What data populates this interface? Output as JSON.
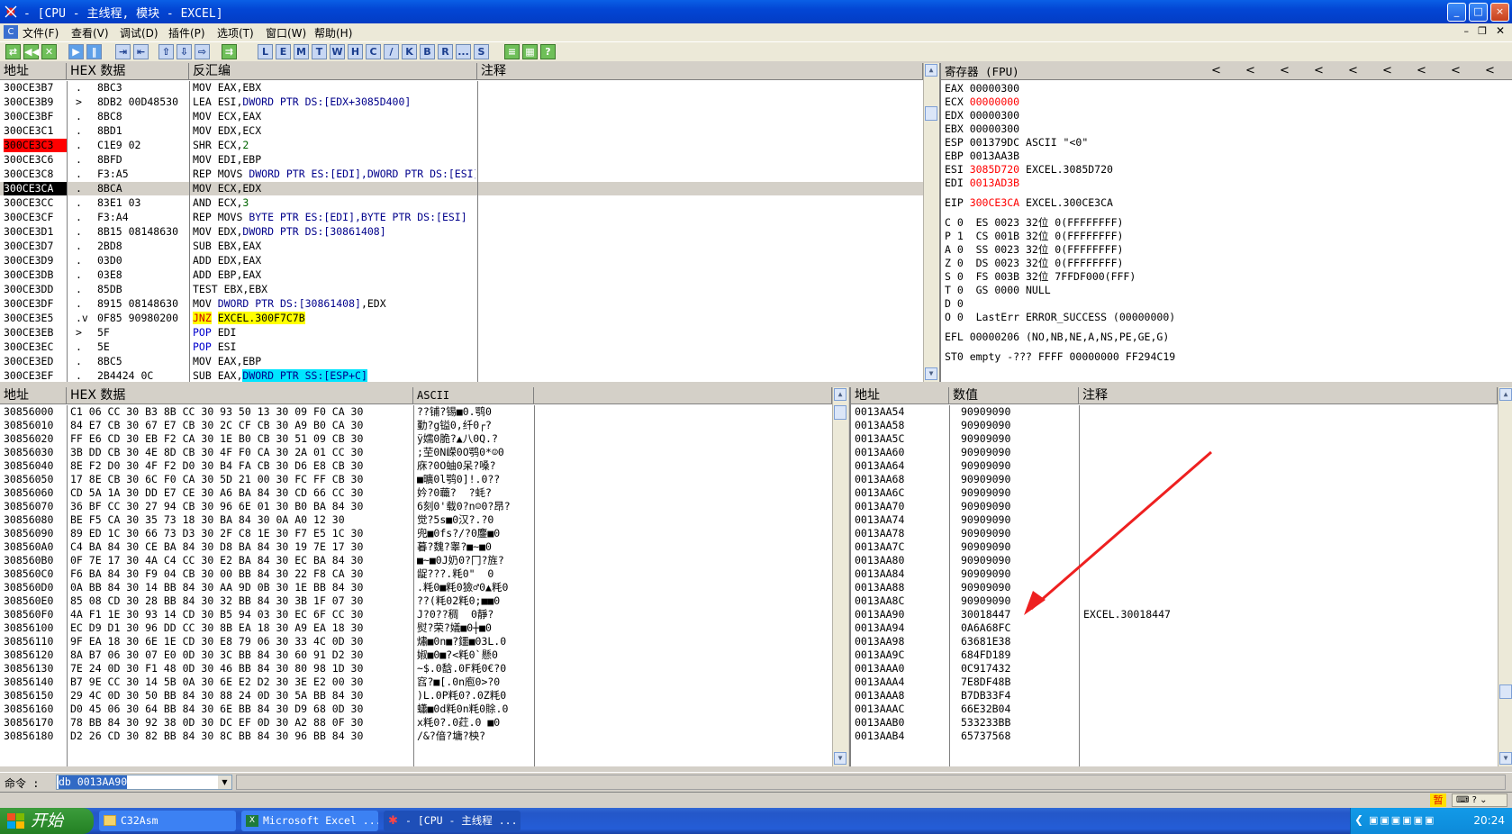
{
  "window": {
    "title": "- [CPU - 主线程, 模块 - EXCEL]",
    "minimize": "_",
    "maximize": "□",
    "close": "×"
  },
  "menu": [
    "文件(F)",
    "查看(V)",
    "调试(D)",
    "插件(P)",
    "选项(T)",
    "窗口(W)",
    "帮助(H)"
  ],
  "toolbar": {
    "play_buttons": [
      "◀◀",
      "✕",
      "▶",
      "‖",
      "⇥",
      "⇤",
      "⇧",
      "⇩",
      "⇨",
      "⇉"
    ],
    "letters": [
      "L",
      "E",
      "M",
      "T",
      "W",
      "H",
      "C",
      "/",
      "K",
      "B",
      "R",
      "...",
      "S"
    ]
  },
  "disasm": {
    "headers": [
      "地址",
      "HEX 数据",
      "反汇编",
      "注释"
    ],
    "rows": [
      {
        "addr": "300CE3B7",
        "mark": ".",
        "hex": "8BC3",
        "asm": [
          [
            "MOV EAX,EBX",
            ""
          ]
        ]
      },
      {
        "addr": "300CE3B9",
        "mark": ">",
        "hex": "8DB2 00D48530",
        "asm": [
          [
            "LEA ESI,",
            ""
          ],
          [
            "DWORD PTR DS:[EDX+3085D400]",
            "blue"
          ]
        ]
      },
      {
        "addr": "300CE3BF",
        "mark": ".",
        "hex": "8BC8",
        "asm": [
          [
            "MOV ECX,EAX",
            ""
          ]
        ]
      },
      {
        "addr": "300CE3C1",
        "mark": ".",
        "hex": "8BD1",
        "asm": [
          [
            "MOV EDX,ECX",
            ""
          ]
        ]
      },
      {
        "addr": "300CE3C3",
        "mark": ".",
        "hex": "C1E9 02",
        "asm": [
          [
            "SHR ECX,",
            ""
          ],
          [
            "2",
            "green"
          ]
        ],
        "hl": "red"
      },
      {
        "addr": "300CE3C6",
        "mark": ".",
        "hex": "8BFD",
        "asm": [
          [
            "MOV EDI,EBP",
            ""
          ]
        ]
      },
      {
        "addr": "300CE3C8",
        "mark": ".",
        "hex": "F3:A5",
        "asm": [
          [
            "REP MOVS ",
            ""
          ],
          [
            "DWORD PTR ES:[EDI],DWORD PTR DS:[ESI]",
            "blue"
          ]
        ]
      },
      {
        "addr": "300CE3CA",
        "mark": ".",
        "hex": "8BCA",
        "asm": [
          [
            "MOV ECX,EDX",
            ""
          ]
        ],
        "hl": "blk"
      },
      {
        "addr": "300CE3CC",
        "mark": ".",
        "hex": "83E1 03",
        "asm": [
          [
            "AND ECX,",
            ""
          ],
          [
            "3",
            "green"
          ]
        ]
      },
      {
        "addr": "300CE3CF",
        "mark": ".",
        "hex": "F3:A4",
        "asm": [
          [
            "REP MOVS ",
            ""
          ],
          [
            "BYTE PTR ES:[EDI],BYTE PTR DS:[ESI]",
            "blue"
          ]
        ]
      },
      {
        "addr": "300CE3D1",
        "mark": ".",
        "hex": "8B15 08148630",
        "asm": [
          [
            "MOV EDX,",
            ""
          ],
          [
            "DWORD PTR DS:[30861408]",
            "blue"
          ]
        ]
      },
      {
        "addr": "300CE3D7",
        "mark": ".",
        "hex": "2BD8",
        "asm": [
          [
            "SUB EBX,EAX",
            ""
          ]
        ]
      },
      {
        "addr": "300CE3D9",
        "mark": ".",
        "hex": "03D0",
        "asm": [
          [
            "ADD EDX,EAX",
            ""
          ]
        ]
      },
      {
        "addr": "300CE3DB",
        "mark": ".",
        "hex": "03E8",
        "asm": [
          [
            "ADD EBP,EAX",
            ""
          ]
        ]
      },
      {
        "addr": "300CE3DD",
        "mark": ".",
        "hex": "85DB",
        "asm": [
          [
            "TEST EBX,EBX",
            ""
          ]
        ]
      },
      {
        "addr": "300CE3DF",
        "mark": ".",
        "hex": "8915 08148630",
        "asm": [
          [
            "MOV ",
            ""
          ],
          [
            "DWORD PTR DS:[30861408]",
            "blue"
          ],
          [
            ",EDX",
            ""
          ]
        ]
      },
      {
        "addr": "300CE3E5",
        "mark": ".v",
        "hex": "0F85 90980200",
        "asm": [
          [
            "JNZ",
            "jnz"
          ],
          [
            " ",
            ""
          ],
          [
            "EXCEL.300F7C7B",
            "yel"
          ]
        ]
      },
      {
        "addr": "300CE3EB",
        "mark": ">",
        "hex": "5F",
        "asm": [
          [
            "POP",
            "pop"
          ],
          [
            " EDI",
            ""
          ]
        ]
      },
      {
        "addr": "300CE3EC",
        "mark": ".",
        "hex": "5E",
        "asm": [
          [
            "POP",
            "pop"
          ],
          [
            " ESI",
            ""
          ]
        ]
      },
      {
        "addr": "300CE3ED",
        "mark": ".",
        "hex": "8BC5",
        "asm": [
          [
            "MOV EAX,EBP",
            ""
          ]
        ]
      },
      {
        "addr": "300CE3EF",
        "mark": ".",
        "hex": "2B4424 0C",
        "asm": [
          [
            "SUB EAX,",
            ""
          ],
          [
            "DWORD PTR SS:[ESP+C]",
            "cyan"
          ]
        ]
      }
    ]
  },
  "registers": {
    "title": "寄存器 (FPU)",
    "arrows": [
      "<",
      "<",
      "<",
      "<",
      "<",
      "<",
      "<",
      "<",
      "<"
    ],
    "lines": [
      [
        [
          "EAX ",
          ""
        ],
        [
          "00000300",
          ""
        ]
      ],
      [
        [
          "ECX ",
          ""
        ],
        [
          "00000000",
          "red"
        ]
      ],
      [
        [
          "EDX ",
          ""
        ],
        [
          "00000300",
          ""
        ]
      ],
      [
        [
          "EBX ",
          ""
        ],
        [
          "00000300",
          ""
        ]
      ],
      [
        [
          "ESP ",
          ""
        ],
        [
          "001379DC",
          ""
        ],
        [
          " ASCII \"<0\"",
          ""
        ]
      ],
      [
        [
          "EBP ",
          ""
        ],
        [
          "0013AA3B",
          ""
        ]
      ],
      [
        [
          "ESI ",
          ""
        ],
        [
          "3085D720",
          "red"
        ],
        [
          " EXCEL.3085D720",
          ""
        ]
      ],
      [
        [
          "EDI ",
          ""
        ],
        [
          "0013AD3B",
          "red"
        ]
      ],
      [
        [
          "",
          ""
        ]
      ],
      [
        [
          "EIP ",
          ""
        ],
        [
          "300CE3CA",
          "red"
        ],
        [
          " EXCEL.300CE3CA",
          ""
        ]
      ],
      [
        [
          "",
          ""
        ]
      ],
      [
        [
          "C 0  ES 0023 32位 0(FFFFFFFF)",
          ""
        ]
      ],
      [
        [
          "P 1  CS 001B 32位 0(FFFFFFFF)",
          ""
        ]
      ],
      [
        [
          "A 0  SS 0023 32位 0(FFFFFFFF)",
          ""
        ]
      ],
      [
        [
          "Z 0  DS 0023 32位 0(FFFFFFFF)",
          ""
        ]
      ],
      [
        [
          "S 0  FS 003B 32位 7FFDF000(FFF)",
          ""
        ]
      ],
      [
        [
          "T 0  GS 0000 NULL",
          ""
        ]
      ],
      [
        [
          "D 0",
          ""
        ]
      ],
      [
        [
          "O 0  LastErr ERROR_SUCCESS (00000000)",
          ""
        ]
      ],
      [
        [
          "",
          ""
        ]
      ],
      [
        [
          "EFL 00000206 (NO,NB,NE,A,NS,PE,GE,G)",
          ""
        ]
      ],
      [
        [
          "",
          ""
        ]
      ],
      [
        [
          "ST0 empty -??? FFFF 00000000 FF294C19",
          ""
        ]
      ]
    ]
  },
  "dump": {
    "headers": [
      "地址",
      "HEX 数据",
      "ASCII"
    ],
    "rows": [
      [
        "30856000",
        "C1 06 CC 30 B3 8B CC 30 93 50 13 30 09 F0 CA 30",
        "??铺?锡■0.鹗0"
      ],
      [
        "30856010",
        "84 E7 CB 30 67 E7 CB 30 2C CF CB 30 A9 B0 CA 30",
        "勤?g镒0,纤0┌?"
      ],
      [
        "30856020",
        "FF E6 CD 30 EB F2 CA 30 1E B0 CB 30 51 09 CB 30",
        "ÿ嬬0脆?▲八0Q.?"
      ],
      [
        "30856030",
        "3B DD CB 30 4E 8D CB 30 4F F0 CA 30 2A 01 CC 30",
        ";茔0N嵘0O鹗0*☺0"
      ],
      [
        "30856040",
        "8E F2 D0 30 4F F2 D0 30 B4 FA CB 30 D6 E8 CB 30",
        "庥?0O蚰0呆?嗓?"
      ],
      [
        "30856050",
        "17 8E CB 30 6C F0 CA 30 5D 21 00 30 FC FF CB 30",
        "■曠0l鹗0]!.0??"
      ],
      [
        "30856060",
        "CD 5A 1A 30 DD E7 CE 30 A6 BA 84 30 CD 66 CC 30",
        "妗?0蘵?  ?蚝?"
      ],
      [
        "30856070",
        "36 BF CC 30 27 94 CB 30 96 6E 01 30 B0 BA 84 30",
        "6刻0'载0?n☺0?昂?"
      ],
      [
        "30856080",
        "BE F5 CA 30 35 73 18 30 BA 84 30 0A A0 12 30",
        "觉?5s■0汉?.?0"
      ],
      [
        "30856090",
        "89 ED 1C 30 66 73 D3 30 2F C8 1E 30 F7 E5 1C 30",
        "兜■0fs?/?0鏖■0"
      ],
      [
        "308560A0",
        "C4 BA 84 30 CE BA 84 30 D8 BA 84 30 19 7E 17 30",
        "暮?魏?睾?■~■0"
      ],
      [
        "308560B0",
        "0F 7E 17 30 4A C4 CC 30 E2 BA 84 30 EC BA 84 30",
        "■~■0J奶0?冂?旌?"
      ],
      [
        "308560C0",
        "F6 BA 84 30 F9 04 CB 30 00 BB 84 30 22 F8 CA 30",
        "龊???.粍0\"  0"
      ],
      [
        "308560D0",
        "0A BB 84 30 14 BB 84 30 AA 9D 0B 30 1E BB 84 30",
        ".粍0■粍0獫♂0▲粍0"
      ],
      [
        "308560E0",
        "85 08 CD 30 28 BB 84 30 32 BB 84 30 3B 1F 07 30",
        "??(粍02粍0;■■0"
      ],
      [
        "308560F0",
        "4A F1 1E 30 93 14 CD 30 B5 94 03 30 EC 6F CC 30",
        "J?0??稠  0靜?"
      ],
      [
        "30856100",
        "EC D9 D1 30 96 DD CC 30 8B EA 18 30 A9 EA 18 30",
        "熨?荣?嬟■0┼■0"
      ],
      [
        "30856110",
        "9F EA 18 30 6E 1E CD 30 E8 79 06 30 33 4C 0D 30",
        "熽■0n■?鑩■03L.0"
      ],
      [
        "30856120",
        "8A B7 06 30 07 E0 0D 30 3C BB 84 30 60 91 D2 30",
        "婌■0■?<粍0`懸0"
      ],
      [
        "30856130",
        "7E 24 0D 30 F1 48 0D 30 46 BB 84 30 80 98 1D 30",
        "~$.0馠.0F粍0€?0"
      ],
      [
        "30856140",
        "B7 9E CC 30 14 5B 0A 30 6E E2 D2 30 3E E2 00 30",
        "窞?■[.0n庖0>?0"
      ],
      [
        "30856150",
        "29 4C 0D 30 50 BB 84 30 88 24 0D 30 5A BB 84 30",
        ")L.0P粍0?.0Z粍0"
      ],
      [
        "30856160",
        "D0 45 06 30 64 BB 84 30 6E BB 84 30 D9 68 0D 30",
        "蠨■0d粍0n粍0賖.0"
      ],
      [
        "30856170",
        "78 BB 84 30 92 38 0D 30 DC EF 0D 30 A2 88 0F 30",
        "x粍0?.0荭.0 ■0"
      ],
      [
        "30856180",
        "D2 26 CD 30 82 BB 84 30 8C BB 84 30 96 BB 84 30",
        "/&?偣?墉?柍?"
      ]
    ]
  },
  "stack": {
    "headers": [
      "地址",
      "数值",
      "注释"
    ],
    "rows": [
      [
        "0013AA54",
        "90909090",
        ""
      ],
      [
        "0013AA58",
        "90909090",
        ""
      ],
      [
        "0013AA5C",
        "90909090",
        ""
      ],
      [
        "0013AA60",
        "90909090",
        ""
      ],
      [
        "0013AA64",
        "90909090",
        ""
      ],
      [
        "0013AA68",
        "90909090",
        ""
      ],
      [
        "0013AA6C",
        "90909090",
        ""
      ],
      [
        "0013AA70",
        "90909090",
        ""
      ],
      [
        "0013AA74",
        "90909090",
        ""
      ],
      [
        "0013AA78",
        "90909090",
        ""
      ],
      [
        "0013AA7C",
        "90909090",
        ""
      ],
      [
        "0013AA80",
        "90909090",
        ""
      ],
      [
        "0013AA84",
        "90909090",
        ""
      ],
      [
        "0013AA88",
        "90909090",
        ""
      ],
      [
        "0013AA8C",
        "90909090",
        ""
      ],
      [
        "0013AA90",
        "30018447",
        "EXCEL.30018447"
      ],
      [
        "0013AA94",
        "0A6A68FC",
        ""
      ],
      [
        "0013AA98",
        "63681E38",
        ""
      ],
      [
        "0013AA9C",
        "684FD189",
        ""
      ],
      [
        "0013AAA0",
        "0C917432",
        ""
      ],
      [
        "0013AAA4",
        "7E8DF48B",
        ""
      ],
      [
        "0013AAA8",
        "B7DB33F4",
        ""
      ],
      [
        "0013AAAC",
        "66E32B04",
        ""
      ],
      [
        "0013AAB0",
        "533233BB",
        ""
      ],
      [
        "0013AAB4",
        "65737568",
        ""
      ]
    ]
  },
  "command": {
    "label": "命令 :",
    "value": "db 0013AA90"
  },
  "status": {
    "right_text": "暂"
  },
  "taskbar": {
    "start": "开始",
    "tasks": [
      "C32Asm",
      "Microsoft Excel ...",
      "- [CPU - 主线程 ..."
    ],
    "clock": "20:24"
  },
  "colors": {
    "accent_red": "#ff0000",
    "highlight_yellow": "#ffff00",
    "highlight_cyan": "#00e5ff",
    "arrow": "#ee2020"
  }
}
